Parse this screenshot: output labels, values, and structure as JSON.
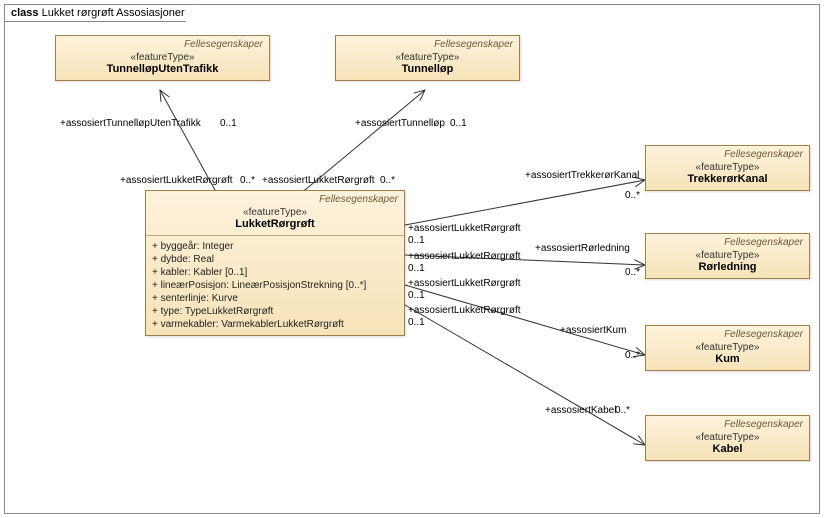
{
  "frame": {
    "prefix": "class",
    "title": "Lukket rørgrøft Assosiasjoner"
  },
  "classes": {
    "tunnelUten": {
      "group": "Fellesegenskaper",
      "stereo": "«featureType»",
      "name": "TunnelløpUtenTrafikk"
    },
    "tunnellop": {
      "group": "Fellesegenskaper",
      "stereo": "«featureType»",
      "name": "Tunnelløp"
    },
    "lukket": {
      "group": "Fellesegenskaper",
      "stereo": "«featureType»",
      "name": "LukketRørgrøft",
      "attrs": [
        "+   byggeår: Integer",
        "+   dybde: Real",
        "+   kabler: Kabler [0..1]",
        "+   lineærPosisjon: LineærPosisjonStrekning [0..*]",
        "+   senterlinje: Kurve",
        "+   type: TypeLukketRørgrøft",
        "+   varmekabler: VarmekablerLukketRørgrøft"
      ]
    },
    "trekkeror": {
      "group": "Fellesegenskaper",
      "stereo": "«featureType»",
      "name": "TrekkerørKanal"
    },
    "rorledning": {
      "group": "Fellesegenskaper",
      "stereo": "«featureType»",
      "name": "Rørledning"
    },
    "kum": {
      "group": "Fellesegenskaper",
      "stereo": "«featureType»",
      "name": "Kum"
    },
    "kabel": {
      "group": "Fellesegenskaper",
      "stereo": "«featureType»",
      "name": "Kabel"
    }
  },
  "labels": {
    "l_assTunnelUten": "+assosiertTunnelløpUtenTrafikk",
    "l_tunnelUtenMult": "0..1",
    "l_assTunnellop": "+assosiertTunnelløp",
    "l_tunnellopMult": "0..1",
    "l_assLukket1": "+assosiertLukketRørgrøft",
    "l_lukketMult1": "0..*",
    "l_assLukket1b": "+assosiertLukketRørgrøft",
    "l_lukketMult1b": "0..*",
    "l_assLukketR_trek": "+assosiertLukketRørgrøft",
    "l_multR_trek": "0..1",
    "l_assTrek": "+assosiertTrekkerørKanal",
    "l_multTrek": "0..*",
    "l_assLukketR_ror": "+assosiertLukketRørgrøft",
    "l_multR_ror": "0..1",
    "l_assRor": "+assosiertRørledning",
    "l_multRor": "0..*",
    "l_assLukketR_kum": "+assosiertLukketRørgrøft",
    "l_multR_kum": "0..1",
    "l_assKum": "+assosiertKum",
    "l_multKum": "0..*",
    "l_assLukketR_kabel": "+assosiertLukketRørgrøft",
    "l_multR_kabel": "0..1",
    "l_assKabel": "+assosiertKabel",
    "l_multKabel": "0..*"
  },
  "chart_data": {
    "type": "uml-class-diagram",
    "title": "Lukket rørgrøft Assosiasjoner",
    "classes": [
      {
        "name": "TunnelløpUtenTrafikk",
        "stereotype": "featureType",
        "group": "Fellesegenskaper"
      },
      {
        "name": "Tunnelløp",
        "stereotype": "featureType",
        "group": "Fellesegenskaper"
      },
      {
        "name": "LukketRørgrøft",
        "stereotype": "featureType",
        "group": "Fellesegenskaper",
        "attributes": [
          {
            "name": "byggeår",
            "type": "Integer"
          },
          {
            "name": "dybde",
            "type": "Real"
          },
          {
            "name": "kabler",
            "type": "Kabler",
            "mult": "0..1"
          },
          {
            "name": "lineærPosisjon",
            "type": "LineærPosisjonStrekning",
            "mult": "0..*"
          },
          {
            "name": "senterlinje",
            "type": "Kurve"
          },
          {
            "name": "type",
            "type": "TypeLukketRørgrøft"
          },
          {
            "name": "varmekabler",
            "type": "VarmekablerLukketRørgrøft"
          }
        ]
      },
      {
        "name": "TrekkerørKanal",
        "stereotype": "featureType",
        "group": "Fellesegenskaper"
      },
      {
        "name": "Rørledning",
        "stereotype": "featureType",
        "group": "Fellesegenskaper"
      },
      {
        "name": "Kum",
        "stereotype": "featureType",
        "group": "Fellesegenskaper"
      },
      {
        "name": "Kabel",
        "stereotype": "featureType",
        "group": "Fellesegenskaper"
      }
    ],
    "associations": [
      {
        "from": "LukketRørgrøft",
        "to": "TunnelløpUtenTrafikk",
        "fromRole": "assosiertLukketRørgrøft",
        "fromMult": "0..*",
        "toRole": "assosiertTunnelløpUtenTrafikk",
        "toMult": "0..1",
        "navigable": "both"
      },
      {
        "from": "LukketRørgrøft",
        "to": "Tunnelløp",
        "fromRole": "assosiertLukketRørgrøft",
        "fromMult": "0..*",
        "toRole": "assosiertTunnelløp",
        "toMult": "0..1",
        "navigable": "both"
      },
      {
        "from": "LukketRørgrøft",
        "to": "TrekkerørKanal",
        "fromRole": "assosiertLukketRørgrøft",
        "fromMult": "0..1",
        "toRole": "assosiertTrekkerørKanal",
        "toMult": "0..*",
        "navigable": "both"
      },
      {
        "from": "LukketRørgrøft",
        "to": "Rørledning",
        "fromRole": "assosiertLukketRørgrøft",
        "fromMult": "0..1",
        "toRole": "assosiertRørledning",
        "toMult": "0..*",
        "navigable": "both"
      },
      {
        "from": "LukketRørgrøft",
        "to": "Kum",
        "fromRole": "assosiertLukketRørgrøft",
        "fromMult": "0..1",
        "toRole": "assosiertKum",
        "toMult": "0..*",
        "navigable": "both"
      },
      {
        "from": "LukketRørgrøft",
        "to": "Kabel",
        "fromRole": "assosiertLukketRørgrøft",
        "fromMult": "0..1",
        "toRole": "assosiertKabel",
        "toMult": "0..*",
        "navigable": "both"
      }
    ]
  }
}
